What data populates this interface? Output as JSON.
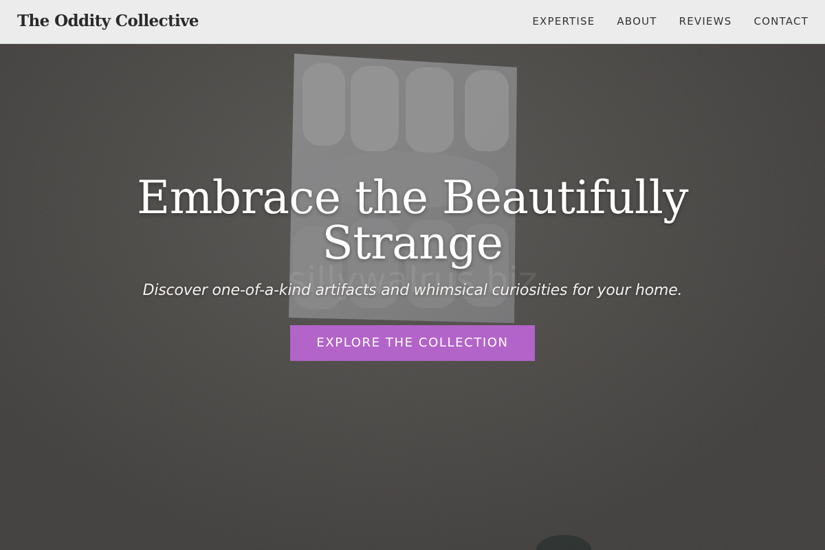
{
  "navbar": {
    "brand": "The Oddity Collective",
    "links": [
      {
        "label": "EXPERTISE"
      },
      {
        "label": "ABOUT"
      },
      {
        "label": "REVIEWS"
      },
      {
        "label": "CONTACT"
      }
    ]
  },
  "hero": {
    "title_line1": "Embrace the Beautifully",
    "title_line2": "Strange",
    "subtitle": "Discover one-of-a-kind artifacts and whimsical curiosities for your home.",
    "cta_label": "EXPLORE THE COLLECTION",
    "watermark": "sillywalrus.biz"
  },
  "colors": {
    "accent": "#b264c8",
    "navbar_bg": "#f2f2f2",
    "brand_text": "#2a2a2a",
    "hero_text": "#ffffff"
  }
}
